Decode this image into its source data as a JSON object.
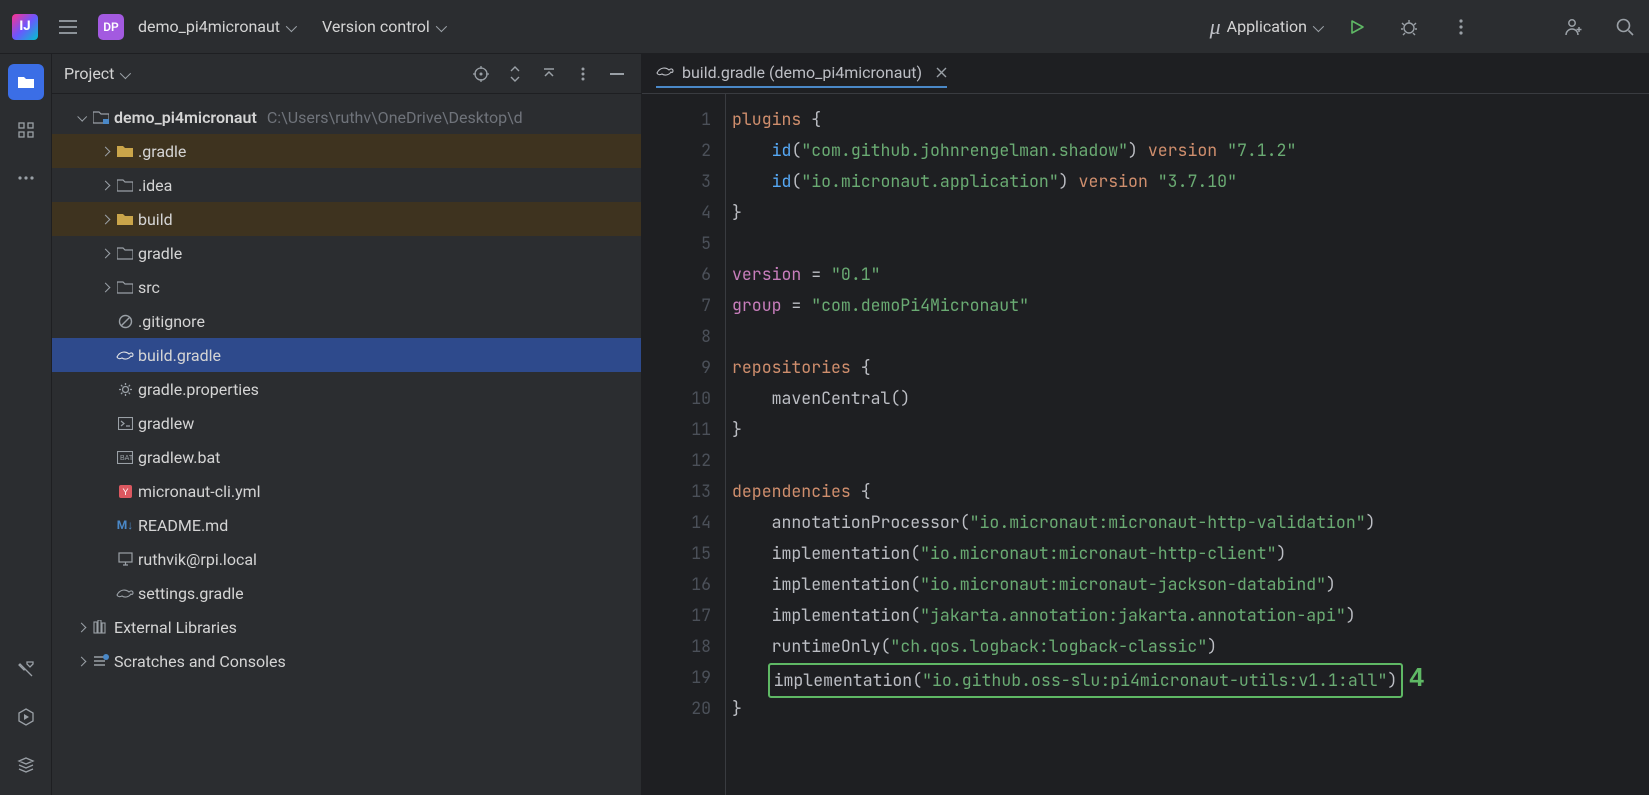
{
  "topbar": {
    "project_badge": "DP",
    "project_name": "demo_pi4micronaut",
    "vcs_label": "Version control",
    "run_config": "Application"
  },
  "project_panel": {
    "title": "Project"
  },
  "tree": {
    "root": {
      "name": "demo_pi4micronaut",
      "path": "C:\\Users\\ruthv\\OneDrive\\Desktop\\d"
    },
    "items": [
      {
        "name": ".gradle",
        "kind": "folder-excluded"
      },
      {
        "name": ".idea",
        "kind": "folder"
      },
      {
        "name": "build",
        "kind": "folder-excluded"
      },
      {
        "name": "gradle",
        "kind": "folder"
      },
      {
        "name": "src",
        "kind": "folder"
      },
      {
        "name": ".gitignore",
        "kind": "ignore"
      },
      {
        "name": "build.gradle",
        "kind": "gradle",
        "selected": true
      },
      {
        "name": "gradle.properties",
        "kind": "gear"
      },
      {
        "name": "gradlew",
        "kind": "shell"
      },
      {
        "name": "gradlew.bat",
        "kind": "bat"
      },
      {
        "name": "micronaut-cli.yml",
        "kind": "yml"
      },
      {
        "name": "README.md",
        "kind": "md"
      },
      {
        "name": "ruthvik@rpi.local",
        "kind": "remote"
      },
      {
        "name": "settings.gradle",
        "kind": "gradle"
      }
    ],
    "bottom": [
      {
        "name": "External Libraries"
      },
      {
        "name": "Scratches and Consoles"
      }
    ]
  },
  "editor": {
    "tab_name": "build.gradle (demo_pi4micronaut)",
    "lines": {
      "l1_plugins": "plugins",
      "l2_id": "id",
      "l2_str": "\"com.github.johnrengelman.shadow\"",
      "l2_kw": "version",
      "l2_ver": "\"7.1.2\"",
      "l3_id": "id",
      "l3_str": "\"io.micronaut.application\"",
      "l3_kw": "version",
      "l3_ver": "\"3.7.10\"",
      "l6_var": "version",
      "l6_str": "\"0.1\"",
      "l7_var": "group",
      "l7_str": "\"com.demoPi4Micronaut\"",
      "l9_kw": "repositories",
      "l10_fn": "mavenCentral",
      "l13_kw": "dependencies",
      "l14_fn": "annotationProcessor",
      "l14_str": "\"io.micronaut:micronaut-http-validation\"",
      "l15_fn": "implementation",
      "l15_str": "\"io.micronaut:micronaut-http-client\"",
      "l16_fn": "implementation",
      "l16_str": "\"io.micronaut:micronaut-jackson-databind\"",
      "l17_fn": "implementation",
      "l17_str": "\"jakarta.annotation:jakarta.annotation-api\"",
      "l18_fn": "runtimeOnly",
      "l18_str": "\"ch.qos.logback:logback-classic\"",
      "l19_fn": "implementation",
      "l19_str": "\"io.github.oss-slu:pi4micronaut-utils:v1.1:all\""
    },
    "callout": "4"
  }
}
